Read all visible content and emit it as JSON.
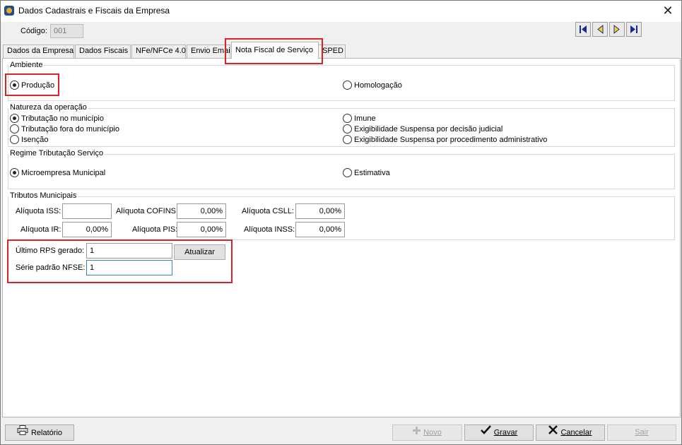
{
  "window": {
    "title": "Dados Cadastrais e Fiscais da Empresa",
    "close_glyph": "✕"
  },
  "codigo": {
    "label": "Código:",
    "value": "001"
  },
  "nav_buttons": [
    "first-record-icon",
    "prev-record-icon",
    "next-record-icon",
    "last-record-icon"
  ],
  "tabs": [
    {
      "label": "Dados da Empresa"
    },
    {
      "label": "Dados Fiscais"
    },
    {
      "label": "NFe/NFCe 4.0"
    },
    {
      "label": "Envio Email"
    },
    {
      "label": "Nota Fiscal de Serviço",
      "active": true
    },
    {
      "label": "SPED"
    }
  ],
  "ambiente": {
    "title": "Ambiente",
    "options": [
      {
        "label": "Produção",
        "checked": true
      },
      {
        "label": "Homologação",
        "checked": false
      }
    ]
  },
  "natureza": {
    "title": "Natureza da operação",
    "options": [
      {
        "label": "Tributação no município",
        "checked": true
      },
      {
        "label": "Tributação fora do município",
        "checked": false
      },
      {
        "label": "Isenção",
        "checked": false
      },
      {
        "label": "Imune",
        "checked": false
      },
      {
        "label": "Exigibilidade Suspensa por decisão judicial",
        "checked": false
      },
      {
        "label": "Exigibilidade Suspensa por procedimento administrativo",
        "checked": false
      }
    ]
  },
  "regime": {
    "title": "Regime Tributação Serviço",
    "options": [
      {
        "label": "Microempresa Municipal",
        "checked": true
      },
      {
        "label": "Estimativa",
        "checked": false
      }
    ]
  },
  "tributos": {
    "title": "Tributos Municipais",
    "iss": {
      "label": "Alíquota ISS:",
      "value": ""
    },
    "cofins": {
      "label": "Alíquota COFINS:",
      "value": "0,00%"
    },
    "csll": {
      "label": "Alíquota CSLL:",
      "value": "0,00%"
    },
    "ir": {
      "label": "Alíquota IR:",
      "value": "0,00%"
    },
    "pis": {
      "label": "Alíquota PIS:",
      "value": "0,00%"
    },
    "inss": {
      "label": "Alíquota INSS:",
      "value": "0,00%"
    }
  },
  "rps": {
    "ultimo_label": "Último RPS gerado:",
    "ultimo_value": "1",
    "atualizar_label": "Atualizar",
    "serie_label": "Série padrão NFSE:",
    "serie_value": "1"
  },
  "footer": {
    "relatorio": "Relatório",
    "novo": "Novo",
    "gravar": "Gravar",
    "cancelar": "Cancelar",
    "sair": "Sair"
  },
  "colors": {
    "highlight": "#d8232a",
    "focus_border": "#3c7fb1"
  }
}
